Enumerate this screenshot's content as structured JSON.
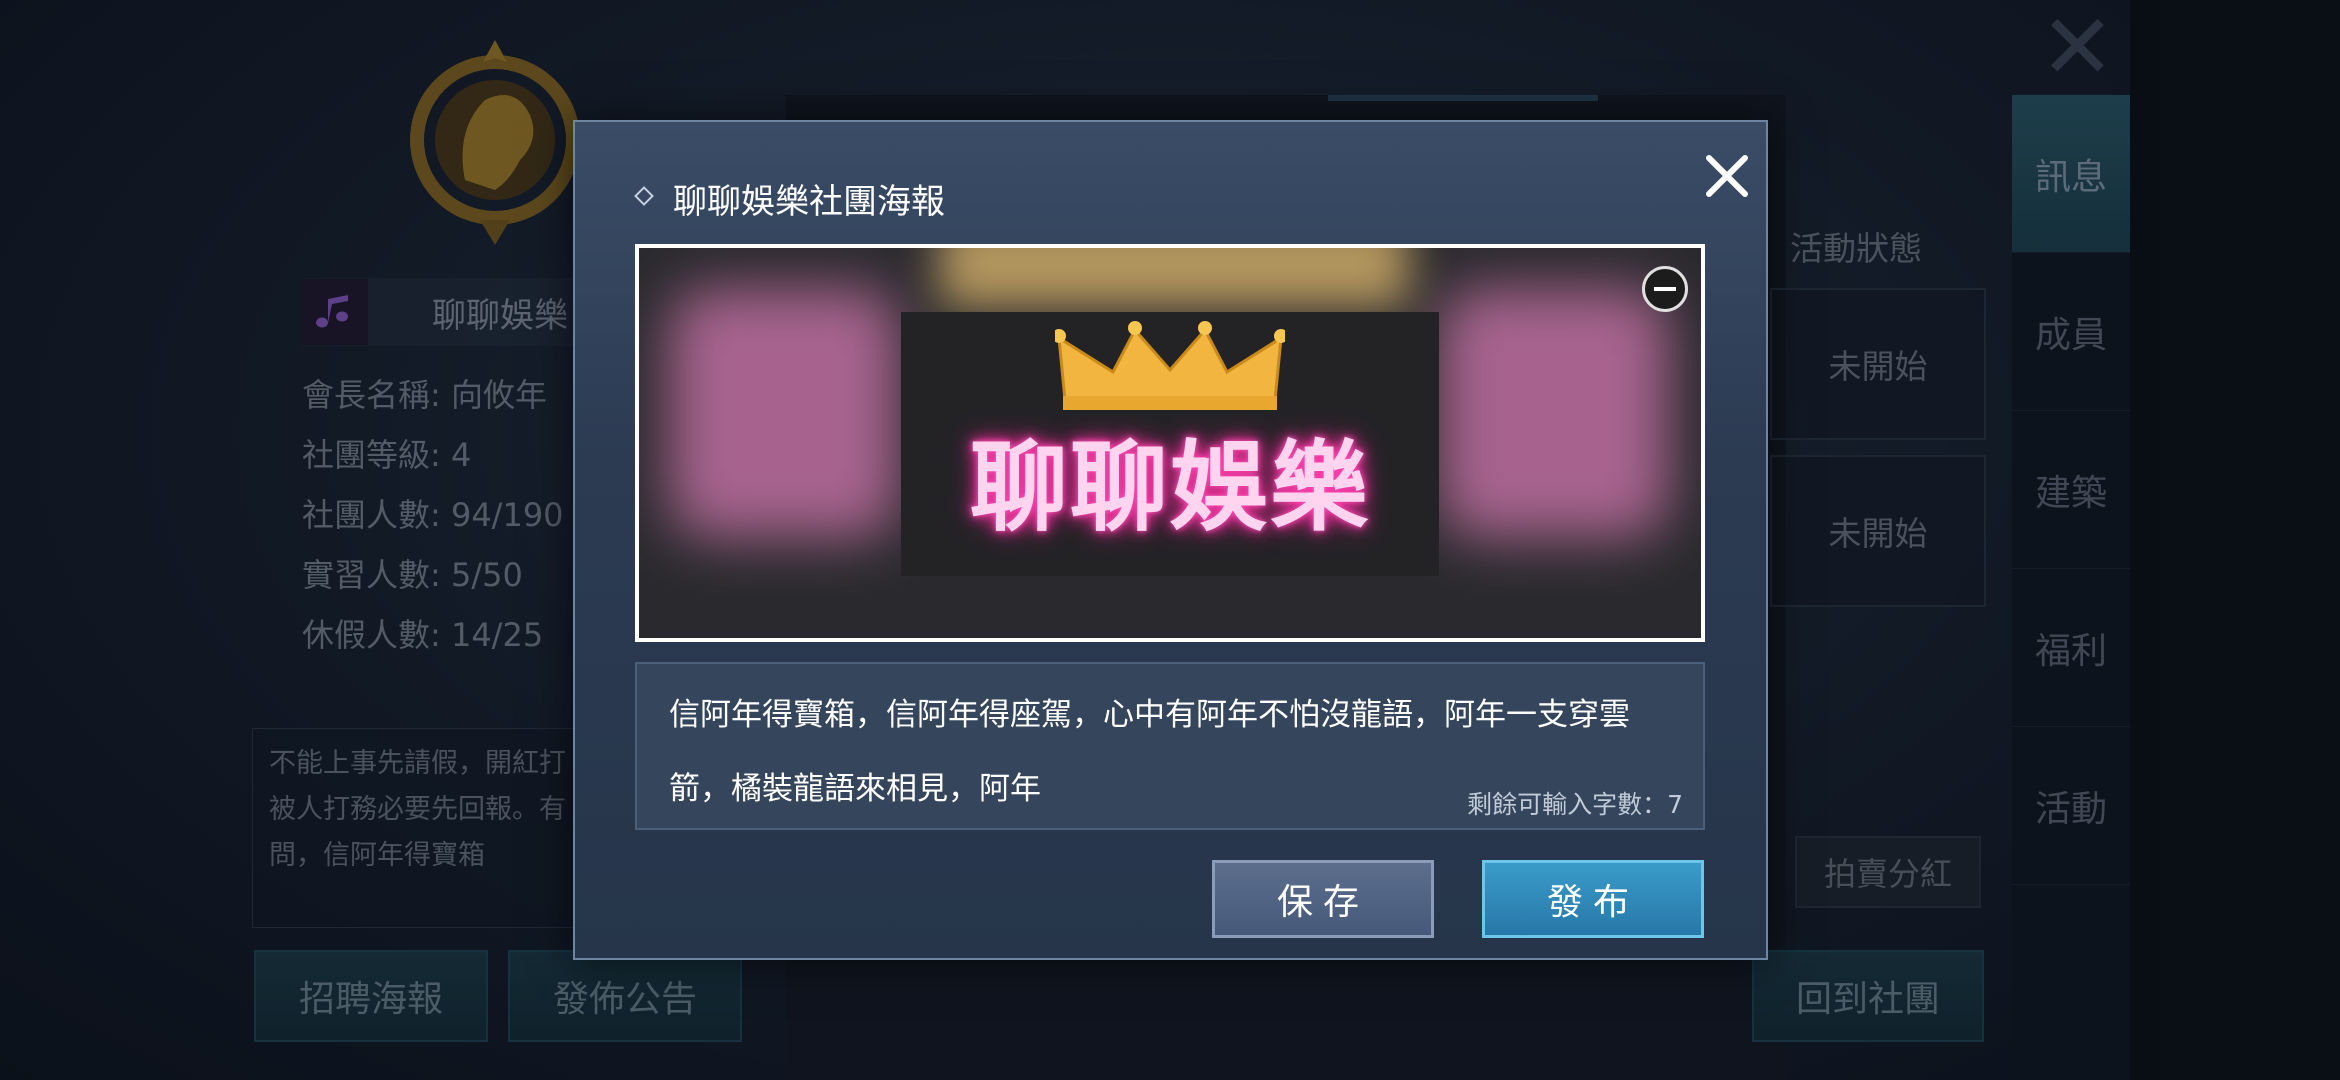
{
  "background": {
    "guild_name": "聊聊娛樂",
    "info_lines": [
      "會長名稱: 向攸年",
      "社團等級: 4",
      "社團人數: 94/190",
      "實習人數: 5/50",
      "休假人數: 14/25"
    ],
    "notice_lines": [
      "不能上事先請假，開紅打",
      "被人打務必要先回報。有",
      "問，信阿年得寶箱"
    ],
    "buttons": {
      "recruit_poster": "招聘海報",
      "publish_announcement": "發佈公告",
      "auction_dividend": "拍賣分紅",
      "back_to_guild": "回到社團"
    },
    "status_header": "活動狀態",
    "status_cells": [
      "未開始",
      "未開始"
    ],
    "right_nav": [
      "訊息",
      "成員",
      "建築",
      "福利",
      "活動"
    ]
  },
  "modal": {
    "title": "聊聊娛樂社團海報",
    "poster_text": "聊聊娛樂",
    "description": "信阿年得寶箱，信阿年得座駕，心中有阿年不怕沒龍語，阿年一支穿雲箭，橘裝龍語來相見，阿年",
    "remaining_chars": "剩餘可輸入字數：7",
    "save_label": "保存",
    "publish_label": "發布"
  },
  "colors": {
    "publish_button": "#2f88b8",
    "save_button": "#52648a",
    "neon_pink": "#ff3aa8",
    "emblem_gold": "#b8902c"
  }
}
